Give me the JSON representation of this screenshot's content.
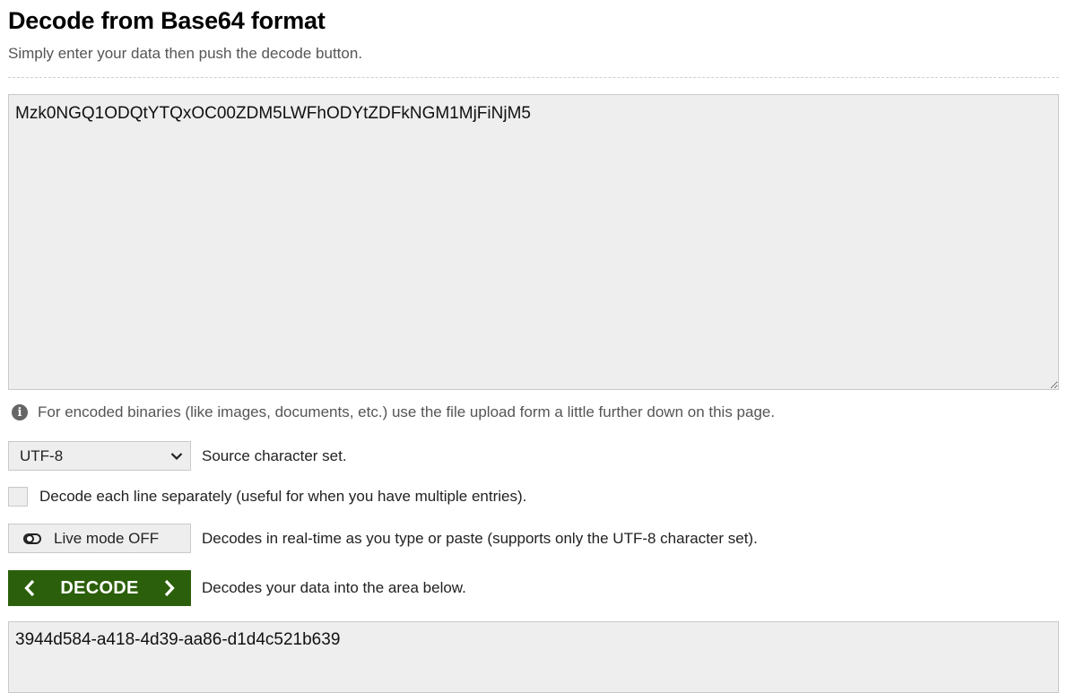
{
  "header": {
    "title": "Decode from Base64 format",
    "subtitle": "Simply enter your data then push the decode button."
  },
  "input": {
    "value": "Mzk0NGQ1ODQtYTQxOC00ZDM5LWFhODYtZDFkNGM1MjFiNjM5"
  },
  "info": {
    "icon": "info-icon",
    "text": "For encoded binaries (like images, documents, etc.) use the file upload form a little further down on this page."
  },
  "charset": {
    "selected": "UTF-8",
    "label": "Source character set."
  },
  "line_separately": {
    "checked": false,
    "label": "Decode each line separately (useful for when you have multiple entries)."
  },
  "live_mode": {
    "button_label": "Live mode OFF",
    "description": "Decodes in real-time as you type or paste (supports only the UTF-8 character set)."
  },
  "decode": {
    "button_label": "DECODE",
    "description": "Decodes your data into the area below."
  },
  "output": {
    "value": "3944d584-a418-4d39-aa86-d1d4c521b639"
  },
  "colors": {
    "decode_button_bg": "#2c5f0b",
    "field_bg": "#eeeeee"
  }
}
